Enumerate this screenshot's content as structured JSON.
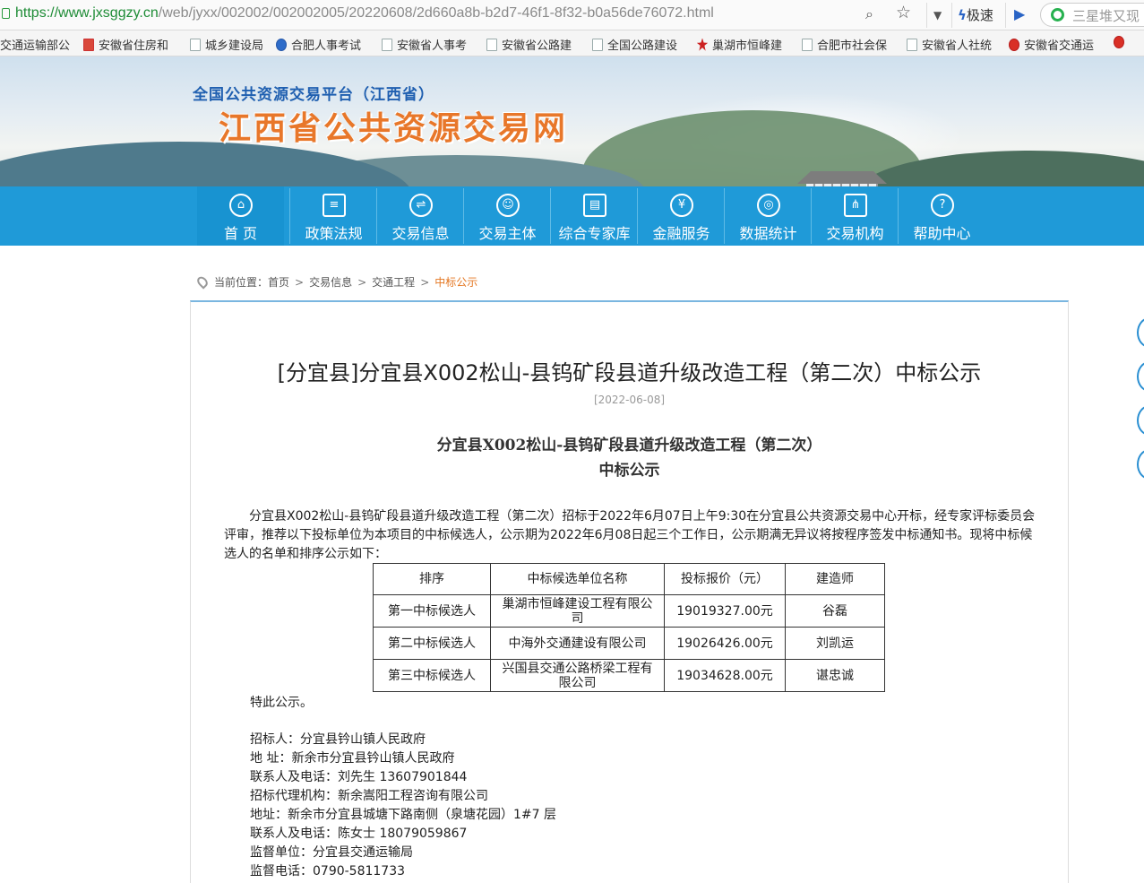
{
  "browser": {
    "url_host": "https://www.jxsggzy.cn",
    "url_path": "/web/jyxx/002002/002002005/20220608/2d660a8b-b2d7-46f1-8f32-b0a56de76072.html",
    "speed_label": "极速",
    "search_text": "三星堆又现"
  },
  "bookmarks": [
    "交通运输部公",
    "安徽省住房和",
    "城乡建设局",
    "合肥人事考试",
    "安徽省人事考",
    "安徽省公路建",
    "全国公路建设",
    "巢湖市恒峰建",
    "合肥市社会保",
    "安徽省人社统",
    "安徽省交通运"
  ],
  "banner": {
    "subtitle": "全国公共资源交易平台（江西省）",
    "title": "江西省公共资源交易网"
  },
  "nav": [
    {
      "label": "首 页",
      "icon": "home-icon",
      "glyph": "⌂"
    },
    {
      "label": "政策法规",
      "icon": "document-icon",
      "glyph": "≡"
    },
    {
      "label": "交易信息",
      "icon": "exchange-icon",
      "glyph": "⇌"
    },
    {
      "label": "交易主体",
      "icon": "user-icon",
      "glyph": "☺"
    },
    {
      "label": "综合专家库",
      "icon": "id-card-icon",
      "glyph": "▤"
    },
    {
      "label": "金融服务",
      "icon": "yen-icon",
      "glyph": "¥"
    },
    {
      "label": "数据统计",
      "icon": "stack-icon",
      "glyph": "◎"
    },
    {
      "label": "交易机构",
      "icon": "org-chart-icon",
      "glyph": "⋔"
    },
    {
      "label": "帮助中心",
      "icon": "help-icon",
      "glyph": "?"
    }
  ],
  "breadcrumb": {
    "prefix": "当前位置：",
    "items": [
      "首页",
      "交易信息",
      "交通工程"
    ],
    "current": "中标公示"
  },
  "article": {
    "title": "[分宜县]分宜县X002松山-县钨矿段县道升级改造工程（第二次）中标公示",
    "date": "[2022-06-08]",
    "sub_title_1": "分宜县X002松山-县钨矿段县道升级改造工程（第二次）",
    "sub_title_2": "中标公示",
    "intro": "分宜县X002松山-县钨矿段县道升级改造工程（第二次）招标于2022年6月07日上午9:30在分宜县公共资源交易中心开标，经专家评标委员会评审，推荐以下投标单位为本项目的中标候选人，公示期为2022年6月08日起三个工作日，公示期满无异议将按程序签发中标通知书。现将中标候选人的名单和排序公示如下：",
    "table": {
      "headers": [
        "排序",
        "中标候选单位名称",
        "投标报价（元）",
        "建造师"
      ],
      "rows": [
        [
          "第一中标候选人",
          "巢湖市恒峰建设工程有限公司",
          "19019327.00元",
          "谷磊"
        ],
        [
          "第二中标候选人",
          "中海外交通建设有限公司",
          "19026426.00元",
          "刘凯运"
        ],
        [
          "第三中标候选人",
          "兴国县交通公路桥梁工程有限公司",
          "19034628.00元",
          "谌忠诚"
        ]
      ]
    },
    "closing": "特此公示。",
    "contacts": [
      "招标人：分宜县钤山镇人民政府",
      "地  址：新余市分宜县钤山镇人民政府",
      "联系人及电话：刘先生 13607901844",
      "招标代理机构：新余嵩阳工程咨询有限公司",
      "地址：新余市分宜县城塘下路南侧（泉塘花园）1#7 层",
      "联系人及电话：陈女士 18079059867",
      "监督单位：分宜县交通运输局",
      "监督电话：0790-5811733"
    ]
  }
}
